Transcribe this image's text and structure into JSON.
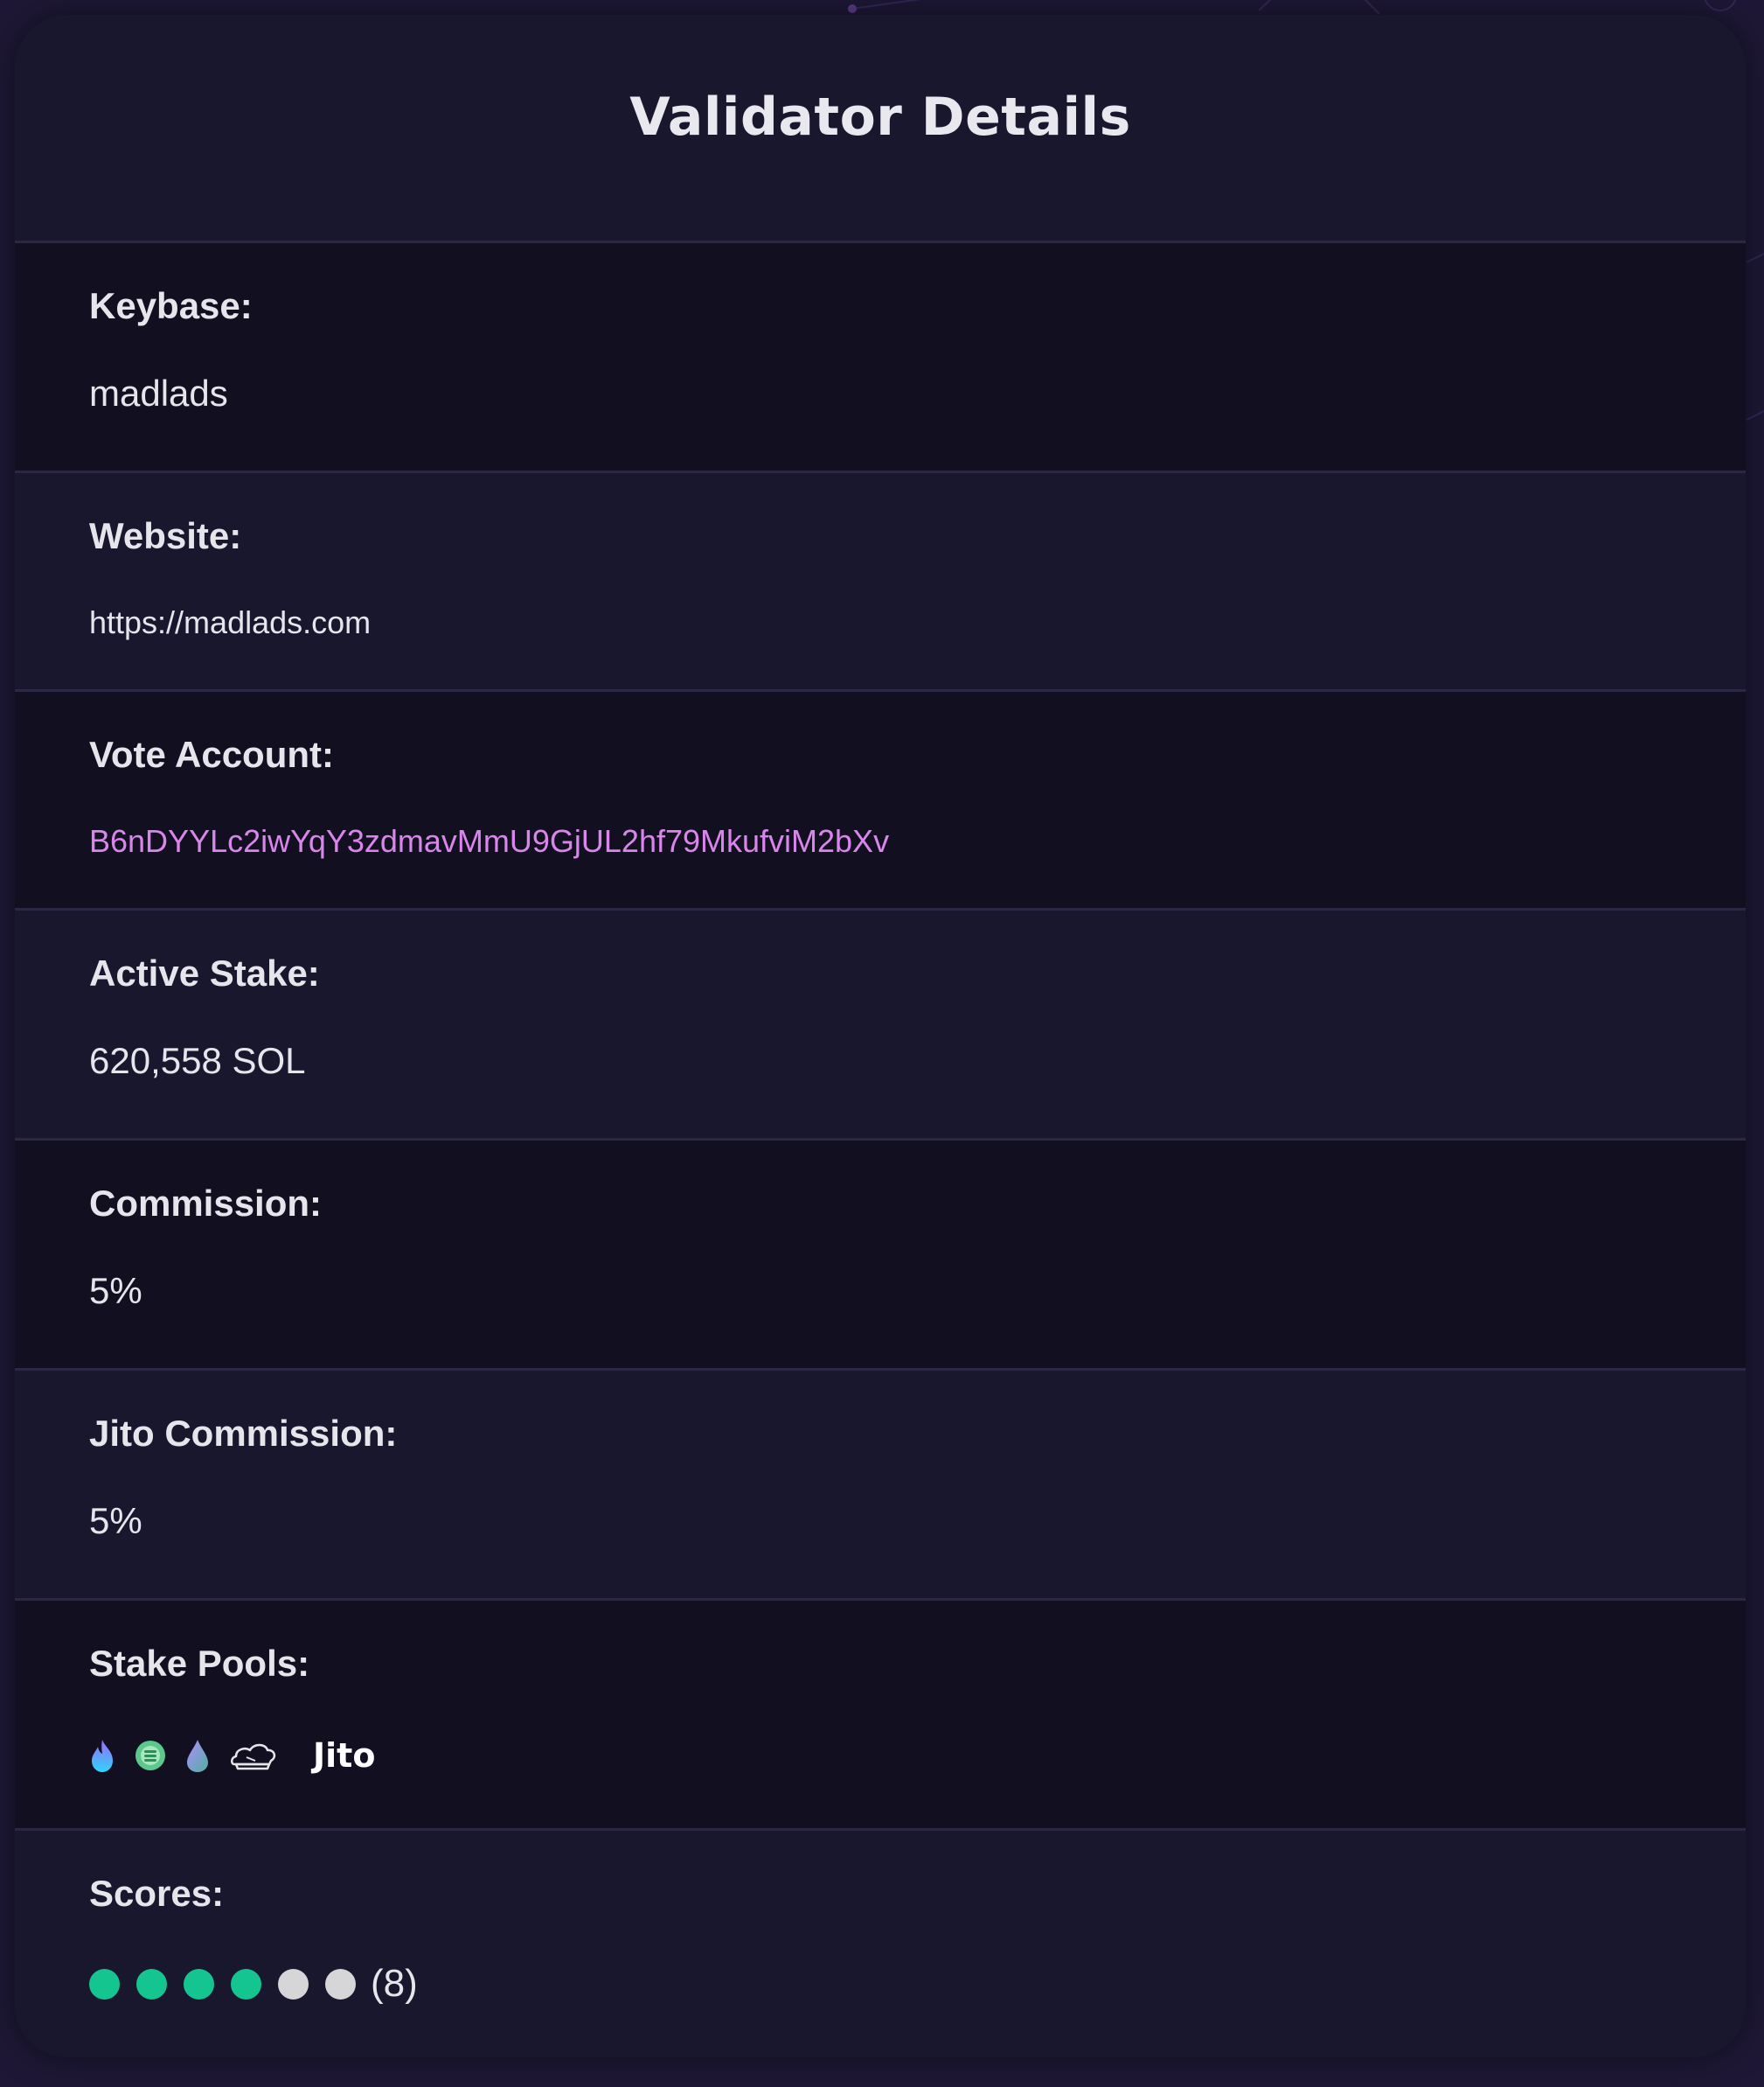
{
  "page": {
    "title": "Validator Details"
  },
  "details": {
    "keybase": {
      "label": "Keybase:",
      "value": "madlads"
    },
    "website": {
      "label": "Website:",
      "value": "https://madlads.com"
    },
    "vote_account": {
      "label": "Vote Account:",
      "value": "B6nDYYLc2iwYqY3zdmavMmU9GjUL2hf79MkufviM2bXv"
    },
    "active_stake": {
      "label": "Active Stake:",
      "value": "620,558 SOL"
    },
    "commission": {
      "label": "Commission:",
      "value": "5%"
    },
    "jito_commission": {
      "label": "Jito Commission:",
      "value": "5%"
    },
    "stake_pools": {
      "label": "Stake Pools:",
      "icons": [
        "flame-pool-icon",
        "green-coin-pool-icon",
        "droplet-pool-icon",
        "chef-hat-pool-icon"
      ],
      "jito_label": "Jito"
    },
    "scores": {
      "label": "Scores:",
      "filled": 4,
      "total": 6,
      "count_text": "(8)"
    }
  },
  "colors": {
    "background": "#1e1836",
    "card": "#19172d",
    "row_dark": "#121020",
    "link": "#d985ec",
    "score_on": "#14c58f",
    "score_off": "#d6d6d8"
  }
}
